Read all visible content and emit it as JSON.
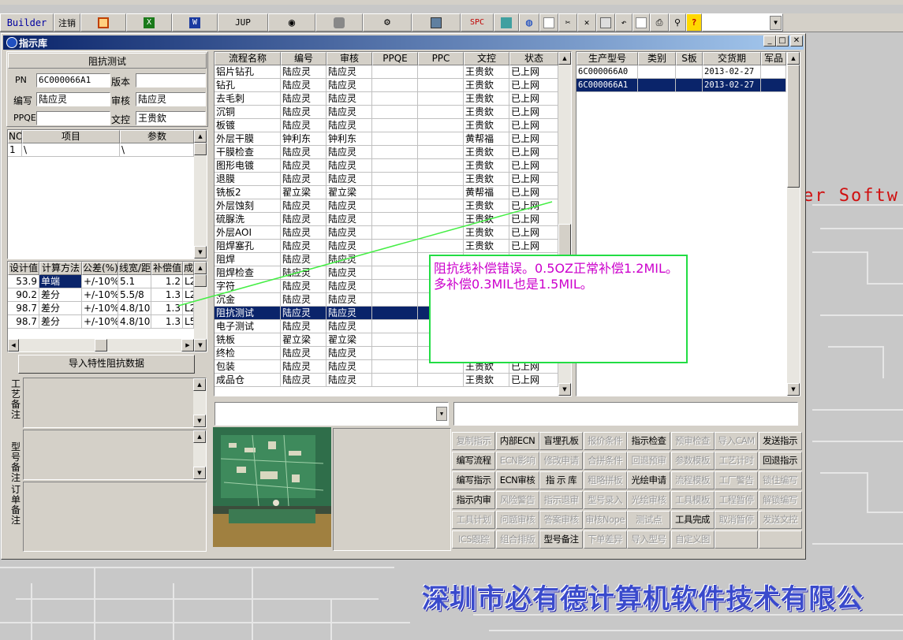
{
  "toolbar": {
    "builder": "Builder",
    "logout": "注销",
    "jup": "JUP",
    "spc": "SPC"
  },
  "window": {
    "title": "指示库"
  },
  "left": {
    "header": "阻抗测试",
    "pn_label": "PN",
    "pn_value": "6C000066A1",
    "version_label": "版本",
    "version_value": "",
    "author_label": "编写",
    "author_value": "陆应灵",
    "review_label": "审核",
    "review_value": "陆应灵",
    "ppqe_label": "PPQE",
    "ppqe_value": "",
    "doc_label": "文控",
    "doc_value": "王贵欽",
    "items_cols": [
      "NO",
      "项目",
      "参数"
    ],
    "items_rows": [
      [
        "1",
        "\\",
        "\\"
      ]
    ],
    "imp_cols": [
      "设计值",
      "计算方法",
      "公差(%)",
      "线宽/距",
      "补偿值",
      "成"
    ],
    "imp_rows": [
      [
        "53.9",
        "单端",
        "+/-10%",
        "5.1",
        "1.2",
        "L2"
      ],
      [
        "90.2",
        "差分",
        "+/-10%",
        "5.5/8",
        "1.3",
        "L2"
      ],
      [
        "98.7",
        "差分",
        "+/-10%",
        "4.8/10.",
        "1.3",
        "L2"
      ],
      [
        "98.7",
        "差分",
        "+/-10%",
        "4.8/10.",
        "1.3",
        "L5"
      ]
    ],
    "import_btn": "导入特性阻抗数据",
    "memo1": "工艺备注",
    "memo2": "型号备注",
    "memo3": "订单备注"
  },
  "flow": {
    "cols": [
      "流程名称",
      "编号",
      "审核",
      "PPQE",
      "PPC",
      "文控",
      "状态"
    ],
    "rows": [
      [
        "铝片钻孔",
        "陆应灵",
        "陆应灵",
        "",
        "",
        "王贵欽",
        "已上网"
      ],
      [
        "钻孔",
        "陆应灵",
        "陆应灵",
        "",
        "",
        "王贵欽",
        "已上网"
      ],
      [
        "去毛刺",
        "陆应灵",
        "陆应灵",
        "",
        "",
        "王贵欽",
        "已上网"
      ],
      [
        "沉铜",
        "陆应灵",
        "陆应灵",
        "",
        "",
        "王贵欽",
        "已上网"
      ],
      [
        "板镀",
        "陆应灵",
        "陆应灵",
        "",
        "",
        "王贵欽",
        "已上网"
      ],
      [
        "外层干膜",
        "钟利东",
        "钟利东",
        "",
        "",
        "黄帮福",
        "已上网"
      ],
      [
        "干膜检查",
        "陆应灵",
        "陆应灵",
        "",
        "",
        "王贵欽",
        "已上网"
      ],
      [
        "图形电镀",
        "陆应灵",
        "陆应灵",
        "",
        "",
        "王贵欽",
        "已上网"
      ],
      [
        "退膜",
        "陆应灵",
        "陆应灵",
        "",
        "",
        "王贵欽",
        "已上网"
      ],
      [
        "铣板2",
        "翟立梁",
        "翟立梁",
        "",
        "",
        "黄帮福",
        "已上网"
      ],
      [
        "外层蚀刻",
        "陆应灵",
        "陆应灵",
        "",
        "",
        "王贵欽",
        "已上网"
      ],
      [
        "硫脲洗",
        "陆应灵",
        "陆应灵",
        "",
        "",
        "王贵欽",
        "已上网"
      ],
      [
        "外层AOI",
        "陆应灵",
        "陆应灵",
        "",
        "",
        "王贵欽",
        "已上网"
      ],
      [
        "阻焊塞孔",
        "陆应灵",
        "陆应灵",
        "",
        "",
        "王贵欽",
        "已上网"
      ],
      [
        "阻焊",
        "陆应灵",
        "陆应灵",
        "",
        "",
        "",
        ""
      ],
      [
        "阻焊检查",
        "陆应灵",
        "陆应灵",
        "",
        "",
        "",
        ""
      ],
      [
        "字符",
        "陆应灵",
        "陆应灵",
        "",
        "",
        "",
        ""
      ],
      [
        "沉金",
        "陆应灵",
        "陆应灵",
        "",
        "",
        "",
        ""
      ],
      [
        "阻抗测试",
        "陆应灵",
        "陆应灵",
        "",
        "",
        "",
        ""
      ],
      [
        "电子测试",
        "陆应灵",
        "陆应灵",
        "",
        "",
        "",
        ""
      ],
      [
        "铣板",
        "翟立梁",
        "翟立梁",
        "",
        "",
        "",
        ""
      ],
      [
        "终检",
        "陆应灵",
        "陆应灵",
        "",
        "",
        "",
        ""
      ],
      [
        "包装",
        "陆应灵",
        "陆应灵",
        "",
        "",
        "王贵欽",
        "已上网"
      ],
      [
        "成品仓",
        "陆应灵",
        "陆应灵",
        "",
        "",
        "王贵欽",
        "已上网"
      ]
    ],
    "selected_index": 18
  },
  "models": {
    "cols": [
      "生产型号",
      "类别",
      "S板",
      "交货期",
      "军品"
    ],
    "rows": [
      [
        "6C000066A0",
        "",
        "",
        "2013-02-27",
        ""
      ],
      [
        "6C000066A1",
        "",
        "",
        "2013-02-27",
        ""
      ]
    ],
    "selected_index": 1
  },
  "annotation": "阻抗线补偿错误。0.5OZ正常补偿1.2MIL。多补偿0.3MIL也是1.5MIL。",
  "actions": [
    [
      {
        "t": "复制指示",
        "d": true
      },
      {
        "t": "内部ECN",
        "d": false
      },
      {
        "t": "盲埋孔板",
        "d": false
      },
      {
        "t": "报价条件",
        "d": true
      },
      {
        "t": "指示检查",
        "d": false
      },
      {
        "t": "预审检查",
        "d": true
      },
      {
        "t": "导入CAM",
        "d": true
      },
      {
        "t": "发送指示",
        "d": false
      }
    ],
    [
      {
        "t": "编写流程",
        "d": false
      },
      {
        "t": "ECN影响",
        "d": true
      },
      {
        "t": "修改申请",
        "d": true
      },
      {
        "t": "合拼条件",
        "d": true
      },
      {
        "t": "回退预审",
        "d": true
      },
      {
        "t": "参数模板",
        "d": true
      },
      {
        "t": "工艺计时",
        "d": true
      },
      {
        "t": "回退指示",
        "d": false
      }
    ],
    [
      {
        "t": "编写指示",
        "d": false
      },
      {
        "t": "ECN审核",
        "d": false
      },
      {
        "t": "指 示 库",
        "d": false
      },
      {
        "t": "粗略拼板",
        "d": true
      },
      {
        "t": "光绘申请",
        "d": false
      },
      {
        "t": "流程模板",
        "d": true
      },
      {
        "t": "工厂警告",
        "d": true
      },
      {
        "t": "锁住编写",
        "d": true
      }
    ],
    [
      {
        "t": "指示内审",
        "d": false
      },
      {
        "t": "风险警告",
        "d": true
      },
      {
        "t": "指示退审",
        "d": true
      },
      {
        "t": "型号录入",
        "d": true
      },
      {
        "t": "光绘审核",
        "d": true
      },
      {
        "t": "工具模板",
        "d": true
      },
      {
        "t": "工程暂停",
        "d": true
      },
      {
        "t": "解锁编写",
        "d": true
      }
    ],
    [
      {
        "t": "工具计划",
        "d": true
      },
      {
        "t": "问题审核",
        "d": true
      },
      {
        "t": "答案审核",
        "d": true
      },
      {
        "t": "审核Nope",
        "d": true
      },
      {
        "t": "测试点",
        "d": true
      },
      {
        "t": "工具完成",
        "d": false
      },
      {
        "t": "取消暂停",
        "d": true
      },
      {
        "t": "发送文控",
        "d": true
      }
    ],
    [
      {
        "t": "ICS跟踪",
        "d": true
      },
      {
        "t": "组合排版",
        "d": true
      },
      {
        "t": "型号备注",
        "d": false
      },
      {
        "t": "下单差异",
        "d": true
      },
      {
        "t": "导入型号",
        "d": true
      },
      {
        "t": "自定义图",
        "d": true
      },
      {
        "t": "",
        "d": true
      },
      {
        "t": "",
        "d": true
      }
    ]
  ],
  "background": {
    "software_text": "er Softw",
    "company": "深圳市必有德计算机软件技术有限公"
  },
  "colors": {
    "selection": "#0a246a",
    "annotation_border": "#22dd44",
    "annotation_text": "#cc00cc",
    "company_text": "#3a4acc"
  }
}
